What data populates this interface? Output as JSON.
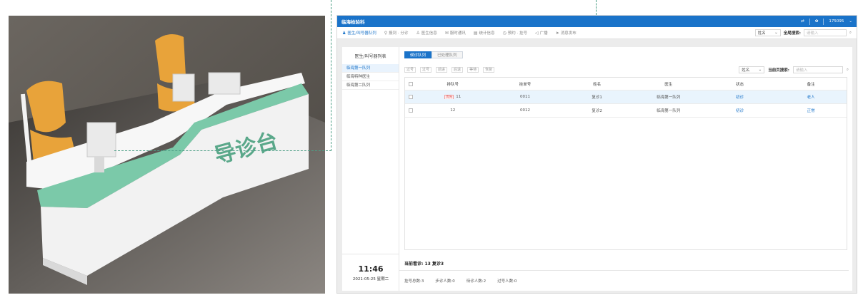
{
  "photo": {
    "desk_sign": "导诊台"
  },
  "app": {
    "title": "临海检验科",
    "header_right": {
      "switch_icon": "swap-icon",
      "settings_icon": "gear-icon",
      "user": "175095"
    },
    "nav": [
      {
        "label": "医生/叫号器队列",
        "icon": "user-icon"
      },
      {
        "label": "报到 · 分诊",
        "icon": "pin-icon"
      },
      {
        "label": "医生信息",
        "icon": "doctor-icon"
      },
      {
        "label": "服时通讯",
        "icon": "chat-icon"
      },
      {
        "label": "统计信息",
        "icon": "chart-icon"
      },
      {
        "label": "预约 · 挂号",
        "icon": "clock-icon"
      },
      {
        "label": "广播",
        "icon": "speaker-icon"
      },
      {
        "label": "消息发布",
        "icon": "send-icon"
      }
    ],
    "global_search": {
      "select": "姓名",
      "label": "全局搜索:",
      "placeholder": "请输入"
    },
    "sidebar": {
      "title": "医生/叫号器列表",
      "items": [
        "临海第一队列",
        "临海特种医生",
        "临海第二队列"
      ],
      "time": "11:46",
      "date": "2021-05-25 星期二"
    },
    "tabs": [
      "候诊队列",
      "已处理队列"
    ],
    "actions": [
      "过号",
      "过号",
      "前进",
      "后退",
      "等待",
      "恢复"
    ],
    "page_search": {
      "select": "姓名",
      "label": "当前页搜索:",
      "placeholder": "请输入"
    },
    "table": {
      "headers": [
        "排队号",
        "挂单号",
        "姓名",
        "医生",
        "状态",
        "备注"
      ],
      "rows": [
        {
          "tag": "优先",
          "queue": "11",
          "reg": "0011",
          "name": "复诊1",
          "doctor": "临海第一队列",
          "status": "初诊",
          "note": "老人"
        },
        {
          "tag": "",
          "queue": "12",
          "reg": "0012",
          "name": "复诊2",
          "doctor": "临海第一队列",
          "status": "初诊",
          "note": "正常"
        }
      ]
    },
    "summary": "当前看诊: 13 复诊3",
    "stats": [
      "挂号总数:3",
      "步诊人数:0",
      "待诊人数:2",
      "过号人数:0"
    ]
  }
}
